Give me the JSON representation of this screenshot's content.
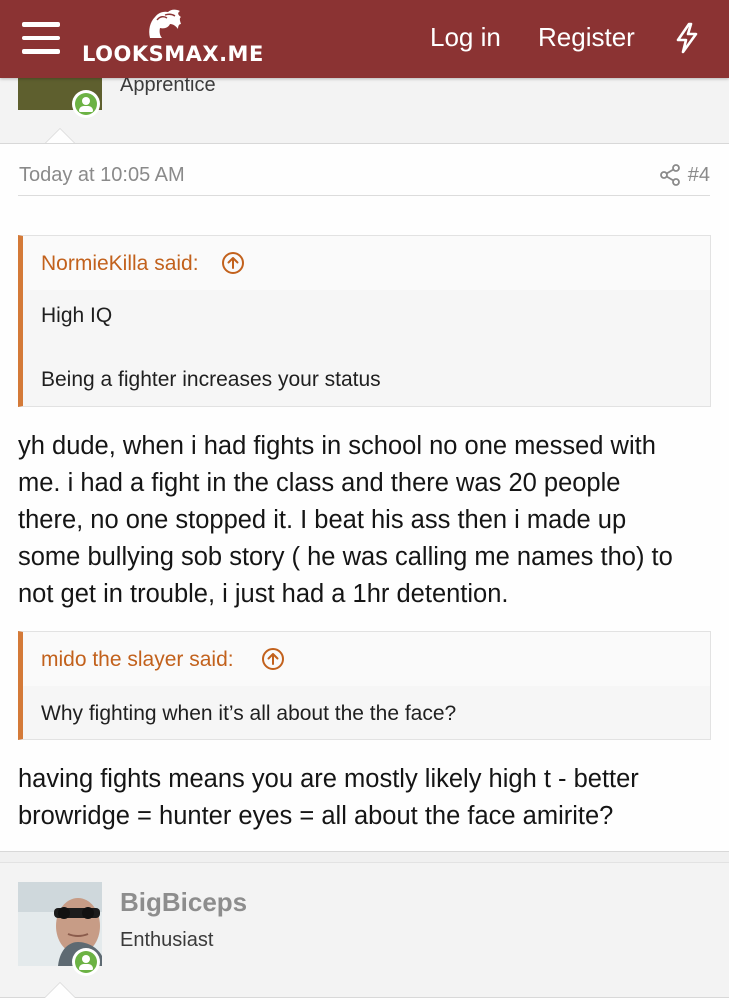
{
  "header": {
    "logo_text": "LOOKSMAX.ME",
    "login_label": "Log in",
    "register_label": "Register",
    "background_color": "#8b3333"
  },
  "previous_post": {
    "user_title": "Apprentice"
  },
  "post": {
    "date": "Today at 10:05 AM",
    "number": "#4",
    "quotes": [
      {
        "author": "NormieKilla said:",
        "lines": [
          "High IQ",
          "Being a fighter increases your status"
        ]
      },
      {
        "author": "mido the slayer said:",
        "lines": [
          "Why fighting when it’s all about the the face?"
        ]
      }
    ],
    "replies": [
      [
        "yh dude, when i had fights in school no one messed with",
        "me. i had a fight in the class and there was 20 people",
        "there, no one stopped it. I beat his ass then i made up",
        "some bullying sob story ( he was calling me names tho) to",
        "not get in trouble, i just had a 1hr detention."
      ],
      [
        "having fights means you are mostly likely high t - better",
        "browridge = hunter eyes = all about the face amirite?"
      ]
    ]
  },
  "next_post": {
    "username": "BigBiceps",
    "user_title": "Enthusiast"
  },
  "colors": {
    "quote_accent": "#d47a38",
    "quote_author": "#c2611c",
    "online": "#6cb244"
  },
  "icons": [
    "menu-icon",
    "logo-hair-icon",
    "bolt-icon",
    "online-status-icon",
    "share-icon",
    "arrow-up-circle-icon"
  ]
}
